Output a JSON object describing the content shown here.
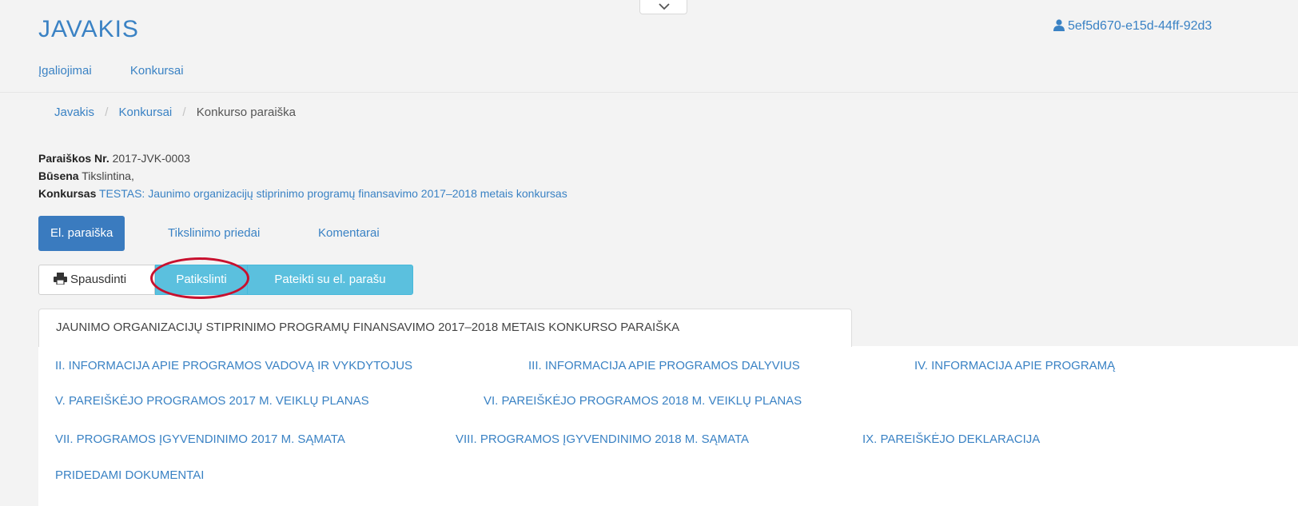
{
  "app": {
    "title": "JAVAKIS",
    "user_id": "5ef5d670-e15d-44ff-92d3"
  },
  "topnav": {
    "items": [
      "Įgaliojimai",
      "Konkursai"
    ]
  },
  "breadcrumb": {
    "items": [
      "Javakis",
      "Konkursai",
      "Konkurso paraiška"
    ],
    "separator": "/"
  },
  "application": {
    "number_label": "Paraiškos Nr.",
    "number_value": "2017-JVK-0003",
    "status_label": "Būsena",
    "status_value": "Tikslintina,",
    "contest_label": "Konkursas",
    "contest_value": "TESTAS: Jaunimo organizacijų stiprinimo programų finansavimo 2017–2018 metais konkursas"
  },
  "tabs": [
    {
      "label": "El. paraiška",
      "active": true
    },
    {
      "label": "Tikslinimo priedai",
      "active": false
    },
    {
      "label": "Komentarai",
      "active": false
    }
  ],
  "toolbar": {
    "print_label": "Spausdinti",
    "patikslinti_label": "Patikslinti",
    "pateikti_label": "Pateikti su el. parašu"
  },
  "sections": {
    "active": "JAUNIMO ORGANIZACIJŲ STIPRINIMO PROGRAMŲ FINANSAVIMO 2017–2018 METAIS KONKURSO PARAIŠKA",
    "links": [
      "II. INFORMACIJA APIE PROGRAMOS VADOVĄ IR VYKDYTOJUS",
      "III. INFORMACIJA APIE PROGRAMOS DALYVIUS",
      "IV. INFORMACIJA APIE PROGRAMĄ",
      "V. PAREIŠKĖJO PROGRAMOS 2017 M. VEIKLŲ PLANAS",
      "VI. PAREIŠKĖJO PROGRAMOS 2018 M. VEIKLŲ PLANAS",
      "VII. PROGRAMOS ĮGYVENDINIMO 2017 M. SĄMATA",
      "VIII. PROGRAMOS ĮGYVENDINIMO 2018 M. SĄMATA",
      "IX. PAREIŠKĖJO DEKLARACIJA",
      "PRIDEDAMI DOKUMENTAI"
    ]
  },
  "icons": {
    "user": "user-icon",
    "print": "print-icon",
    "collapse": "chevron-down-icon"
  },
  "colors": {
    "link": "#3a82c4",
    "primary": "#3a7bbf",
    "info": "#5bc0de",
    "highlight": "#c8102e"
  }
}
